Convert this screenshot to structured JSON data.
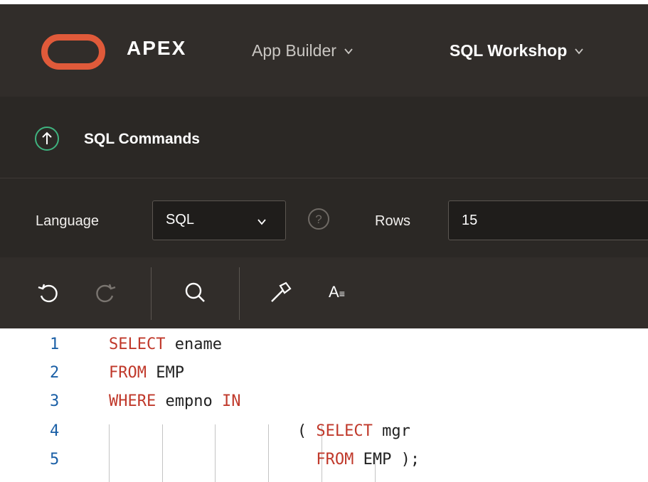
{
  "header": {
    "brand": "APEX",
    "nav": [
      {
        "label": "App Builder",
        "active": false
      },
      {
        "label": "SQL Workshop",
        "active": true
      }
    ],
    "logo_color": "#e05a3a"
  },
  "page": {
    "title": "SQL Commands",
    "icon": "up-arrow-circle-icon"
  },
  "options": {
    "language_label": "Language",
    "language_value": "SQL",
    "help_icon": "help-icon",
    "rows_label": "Rows",
    "rows_value": "15"
  },
  "toolbar": {
    "buttons": [
      "undo-icon",
      "redo-icon",
      "search-icon",
      "hammer-icon",
      "text-format-icon"
    ],
    "format_label": "A"
  },
  "editor": {
    "lines": [
      {
        "num": "1",
        "tokens": [
          {
            "t": "SELECT",
            "kw": true
          },
          {
            "t": " ename",
            "kw": false
          }
        ]
      },
      {
        "num": "2",
        "tokens": [
          {
            "t": "FROM",
            "kw": true
          },
          {
            "t": " EMP",
            "kw": false
          }
        ]
      },
      {
        "num": "3",
        "tokens": [
          {
            "t": "WHERE",
            "kw": true
          },
          {
            "t": " empno ",
            "kw": false
          },
          {
            "t": "IN",
            "kw": true
          }
        ]
      },
      {
        "num": "4",
        "tokens": [
          {
            "t": "                    ( ",
            "kw": false
          },
          {
            "t": "SELECT",
            "kw": true
          },
          {
            "t": " mgr",
            "kw": false
          }
        ]
      },
      {
        "num": "5",
        "tokens": [
          {
            "t": "                      ",
            "kw": false
          },
          {
            "t": "FROM",
            "kw": true
          },
          {
            "t": " EMP );",
            "kw": false
          }
        ]
      }
    ],
    "keyword_color": "#c0392b",
    "line_number_color": "#1a5fa6"
  }
}
